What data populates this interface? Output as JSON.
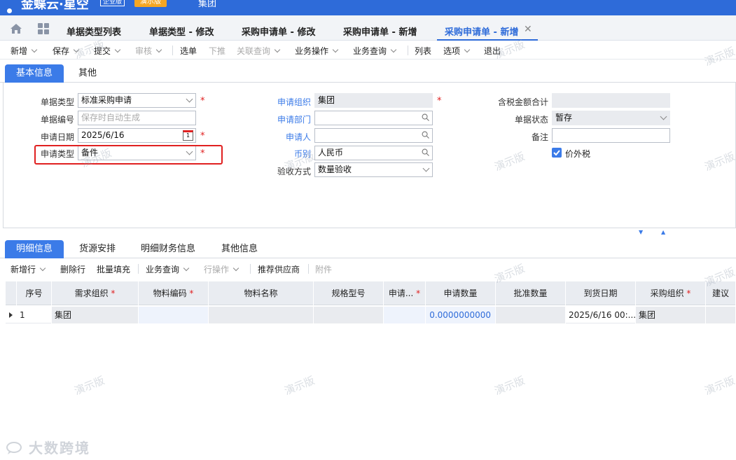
{
  "app": {
    "logo_text": "金蝶云·星空",
    "edition": "企业版",
    "demo_badge": "演示版",
    "org": "集团"
  },
  "tabs": [
    {
      "label": "单据类型列表"
    },
    {
      "label": "单据类型 - 修改"
    },
    {
      "label": "采购申请单 - 修改"
    },
    {
      "label": "采购申请单 - 新增"
    },
    {
      "label": "采购申请单 - 新增",
      "active": true
    }
  ],
  "toolbar": {
    "new": "新增",
    "save": "保存",
    "submit": "提交",
    "audit": "审核",
    "select": "选单",
    "push": "下推",
    "linked_query": "关联查询",
    "biz_op": "业务操作",
    "biz_query": "业务查询",
    "list": "列表",
    "options": "选项",
    "exit": "退出"
  },
  "header_tabs": {
    "basic": "基本信息",
    "other": "其他"
  },
  "form": {
    "bill_type_label": "单据类型",
    "bill_type_value": "标准采购申请",
    "bill_no_label": "单据编号",
    "bill_no_placeholder": "保存时自动生成",
    "apply_date_label": "申请日期",
    "apply_date_value": "2025/6/16",
    "apply_type_label": "申请类型",
    "apply_type_value": "备件",
    "apply_org_label": "申请组织",
    "apply_org_value": "集团",
    "apply_dept_label": "申请部门",
    "apply_dept_value": "",
    "applicant_label": "申请人",
    "applicant_value": "",
    "currency_label": "币别",
    "currency_value": "人民币",
    "accept_method_label": "验收方式",
    "accept_method_value": "数量验收",
    "tax_total_label": "含税金额合计",
    "tax_total_value": "",
    "status_label": "单据状态",
    "status_value": "暂存",
    "remark_label": "备注",
    "remark_value": "",
    "price_excl_tax_label": "价外税",
    "required_mark": "*",
    "calendar_day": "1"
  },
  "detail_tabs": {
    "detail": "明细信息",
    "source": "货源安排",
    "finance": "明细财务信息",
    "other": "其他信息"
  },
  "grid_toolbar": {
    "add_row": "新增行",
    "delete_row": "删除行",
    "batch_fill": "批量填充",
    "biz_query": "业务查询",
    "row_op": "行操作",
    "recommend_supplier": "推荐供应商",
    "attachment": "附件"
  },
  "grid": {
    "columns": [
      "序号",
      "需求组织",
      "物料编码",
      "物料名称",
      "规格型号",
      "申请...",
      "申请数量",
      "批准数量",
      "到货日期",
      "采购组织",
      "建议"
    ],
    "rows": [
      {
        "seq": "1",
        "demand_org": "集团",
        "material_code": "",
        "material_name": "",
        "spec": "",
        "unit": "",
        "apply_qty": "0.0000000000",
        "approved_qty": "",
        "arrival_date": "2025/6/16 00:...",
        "purchase_org": "集团"
      }
    ]
  },
  "watermark_text": "演示版",
  "bottom_logo": "大数跨境",
  "colors": {
    "brand": "#2e6bd9",
    "accent": "#3b7be8",
    "required": "#e02020",
    "highlight": "#e02020"
  }
}
